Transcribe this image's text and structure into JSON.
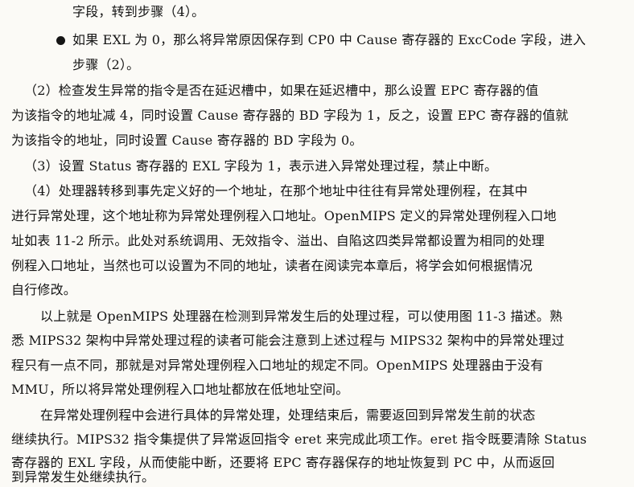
{
  "lines": [
    "字段，转到步骤（4）。",
    "如果 EXL 为 0，那么将异常原因保存到 CP0 中 Cause 寄存器的 ExcCode 字段，进入",
    "步骤（2）。",
    "（2）检查发生异常的指令是否在延迟槽中，如果在延迟槽中，那么设置 EPC 寄存器的值",
    "为该指令的地址减 4，同时设置 Cause 寄存器的 BD 字段为 1，反之，设置 EPC 寄存器的值就",
    "为该指令的地址，同时设置 Cause 寄存器的 BD 字段为 0。",
    "（3）设置 Status 寄存器的 EXL 字段为 1，表示进入异常处理过程，禁止中断。",
    "（4）处理器转移到事先定义好的一个地址，在那个地址中往往有异常处理例程，在其中",
    "进行异常处理，这个地址称为异常处理例程入口地址。OpenMIPS 定义的异常处理例程入口地",
    "址如表 11-2 所示。此处对系统调用、无效指令、溢出、自陷这四类异常都设置为相同的处理",
    "例程入口地址，当然也可以设置为不同的地址，读者在阅读完本章后，将学会如何根据情况",
    "自行修改。",
    "以上就是 OpenMIPS 处理器在检测到异常发生后的处理过程，可以使用图 11-3 描述。熟",
    "悉 MIPS32 架构中异常处理过程的读者可能会注意到上述过程与 MIPS32 架构中的异常处理过",
    "程只有一点不同，那就是对异常处理例程入口地址的规定不同。OpenMIPS 处理器由于没有",
    "MMU，所以将异常处理例程入口地址都放在低地址空间。",
    "在异常处理例程中会进行具体的异常处理，处理结束后，需要返回到异常发生前的状态",
    "继续执行。MIPS32 指令集提供了异常返回指令 eret 来完成此项工作。eret 指令既要清除 Status",
    "寄存器的 EXL 字段，从而使能中断，还要将 EPC 寄存器保存的地址恢复到 PC 中，从而返回",
    "到异常发生处继续执行。"
  ]
}
